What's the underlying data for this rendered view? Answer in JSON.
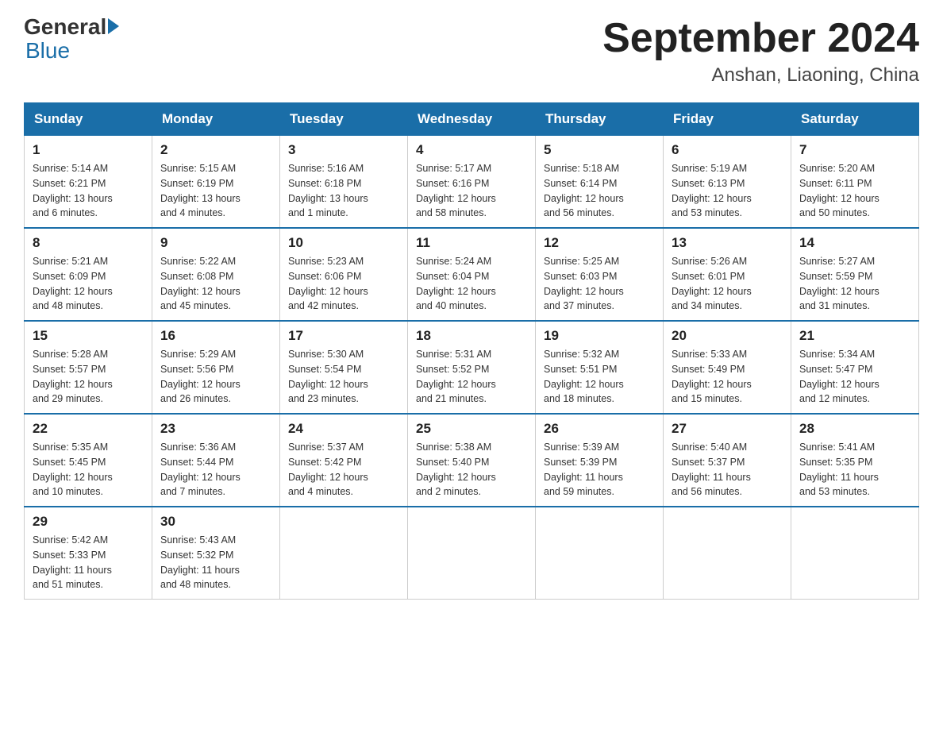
{
  "header": {
    "logo_general": "General",
    "logo_blue": "Blue",
    "month_title": "September 2024",
    "location": "Anshan, Liaoning, China"
  },
  "weekdays": [
    "Sunday",
    "Monday",
    "Tuesday",
    "Wednesday",
    "Thursday",
    "Friday",
    "Saturday"
  ],
  "weeks": [
    [
      {
        "day": "1",
        "info": "Sunrise: 5:14 AM\nSunset: 6:21 PM\nDaylight: 13 hours\nand 6 minutes."
      },
      {
        "day": "2",
        "info": "Sunrise: 5:15 AM\nSunset: 6:19 PM\nDaylight: 13 hours\nand 4 minutes."
      },
      {
        "day": "3",
        "info": "Sunrise: 5:16 AM\nSunset: 6:18 PM\nDaylight: 13 hours\nand 1 minute."
      },
      {
        "day": "4",
        "info": "Sunrise: 5:17 AM\nSunset: 6:16 PM\nDaylight: 12 hours\nand 58 minutes."
      },
      {
        "day": "5",
        "info": "Sunrise: 5:18 AM\nSunset: 6:14 PM\nDaylight: 12 hours\nand 56 minutes."
      },
      {
        "day": "6",
        "info": "Sunrise: 5:19 AM\nSunset: 6:13 PM\nDaylight: 12 hours\nand 53 minutes."
      },
      {
        "day": "7",
        "info": "Sunrise: 5:20 AM\nSunset: 6:11 PM\nDaylight: 12 hours\nand 50 minutes."
      }
    ],
    [
      {
        "day": "8",
        "info": "Sunrise: 5:21 AM\nSunset: 6:09 PM\nDaylight: 12 hours\nand 48 minutes."
      },
      {
        "day": "9",
        "info": "Sunrise: 5:22 AM\nSunset: 6:08 PM\nDaylight: 12 hours\nand 45 minutes."
      },
      {
        "day": "10",
        "info": "Sunrise: 5:23 AM\nSunset: 6:06 PM\nDaylight: 12 hours\nand 42 minutes."
      },
      {
        "day": "11",
        "info": "Sunrise: 5:24 AM\nSunset: 6:04 PM\nDaylight: 12 hours\nand 40 minutes."
      },
      {
        "day": "12",
        "info": "Sunrise: 5:25 AM\nSunset: 6:03 PM\nDaylight: 12 hours\nand 37 minutes."
      },
      {
        "day": "13",
        "info": "Sunrise: 5:26 AM\nSunset: 6:01 PM\nDaylight: 12 hours\nand 34 minutes."
      },
      {
        "day": "14",
        "info": "Sunrise: 5:27 AM\nSunset: 5:59 PM\nDaylight: 12 hours\nand 31 minutes."
      }
    ],
    [
      {
        "day": "15",
        "info": "Sunrise: 5:28 AM\nSunset: 5:57 PM\nDaylight: 12 hours\nand 29 minutes."
      },
      {
        "day": "16",
        "info": "Sunrise: 5:29 AM\nSunset: 5:56 PM\nDaylight: 12 hours\nand 26 minutes."
      },
      {
        "day": "17",
        "info": "Sunrise: 5:30 AM\nSunset: 5:54 PM\nDaylight: 12 hours\nand 23 minutes."
      },
      {
        "day": "18",
        "info": "Sunrise: 5:31 AM\nSunset: 5:52 PM\nDaylight: 12 hours\nand 21 minutes."
      },
      {
        "day": "19",
        "info": "Sunrise: 5:32 AM\nSunset: 5:51 PM\nDaylight: 12 hours\nand 18 minutes."
      },
      {
        "day": "20",
        "info": "Sunrise: 5:33 AM\nSunset: 5:49 PM\nDaylight: 12 hours\nand 15 minutes."
      },
      {
        "day": "21",
        "info": "Sunrise: 5:34 AM\nSunset: 5:47 PM\nDaylight: 12 hours\nand 12 minutes."
      }
    ],
    [
      {
        "day": "22",
        "info": "Sunrise: 5:35 AM\nSunset: 5:45 PM\nDaylight: 12 hours\nand 10 minutes."
      },
      {
        "day": "23",
        "info": "Sunrise: 5:36 AM\nSunset: 5:44 PM\nDaylight: 12 hours\nand 7 minutes."
      },
      {
        "day": "24",
        "info": "Sunrise: 5:37 AM\nSunset: 5:42 PM\nDaylight: 12 hours\nand 4 minutes."
      },
      {
        "day": "25",
        "info": "Sunrise: 5:38 AM\nSunset: 5:40 PM\nDaylight: 12 hours\nand 2 minutes."
      },
      {
        "day": "26",
        "info": "Sunrise: 5:39 AM\nSunset: 5:39 PM\nDaylight: 11 hours\nand 59 minutes."
      },
      {
        "day": "27",
        "info": "Sunrise: 5:40 AM\nSunset: 5:37 PM\nDaylight: 11 hours\nand 56 minutes."
      },
      {
        "day": "28",
        "info": "Sunrise: 5:41 AM\nSunset: 5:35 PM\nDaylight: 11 hours\nand 53 minutes."
      }
    ],
    [
      {
        "day": "29",
        "info": "Sunrise: 5:42 AM\nSunset: 5:33 PM\nDaylight: 11 hours\nand 51 minutes."
      },
      {
        "day": "30",
        "info": "Sunrise: 5:43 AM\nSunset: 5:32 PM\nDaylight: 11 hours\nand 48 minutes."
      },
      {
        "day": "",
        "info": ""
      },
      {
        "day": "",
        "info": ""
      },
      {
        "day": "",
        "info": ""
      },
      {
        "day": "",
        "info": ""
      },
      {
        "day": "",
        "info": ""
      }
    ]
  ]
}
